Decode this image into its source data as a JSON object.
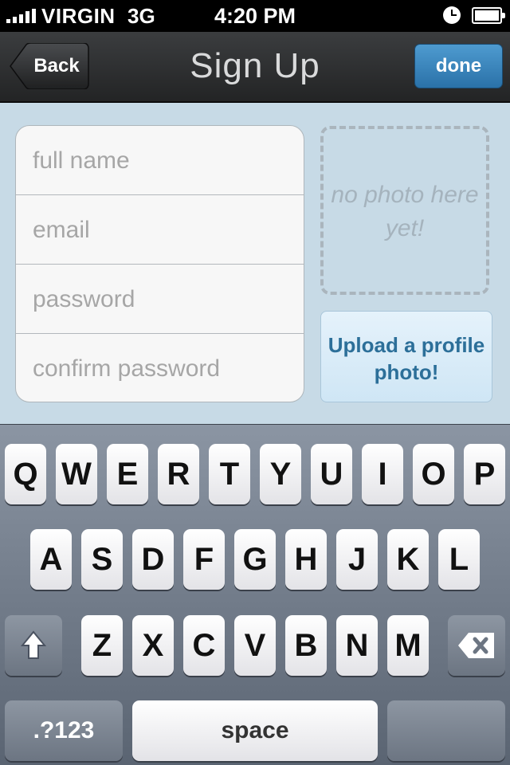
{
  "status_bar": {
    "carrier": "VIRGIN",
    "network": "3G",
    "time": "4:20 PM",
    "signal_icon": "signal-bars-icon",
    "alarm_icon": "clock-icon",
    "battery_icon": "battery-icon"
  },
  "nav": {
    "back_label": "Back",
    "title": "Sign Up",
    "done_label": "done",
    "done_color": "#2f7bb5"
  },
  "form": {
    "fields": [
      {
        "placeholder": "full name"
      },
      {
        "placeholder": "email"
      },
      {
        "placeholder": "password"
      },
      {
        "placeholder": "confirm password"
      }
    ]
  },
  "photo": {
    "placeholder": "no photo here yet!",
    "upload_label": "Upload a profile photo!"
  },
  "keyboard": {
    "row1": [
      "Q",
      "W",
      "E",
      "R",
      "T",
      "Y",
      "U",
      "I",
      "O",
      "P"
    ],
    "row2": [
      "A",
      "S",
      "D",
      "F",
      "G",
      "H",
      "J",
      "K",
      "L"
    ],
    "row3": [
      "Z",
      "X",
      "C",
      "V",
      "B",
      "N",
      "M"
    ],
    "shift_icon": "shift-arrow-icon",
    "backspace_icon": "backspace-icon",
    "numbers_label": ".?123",
    "space_label": "space",
    "return_label": ""
  }
}
